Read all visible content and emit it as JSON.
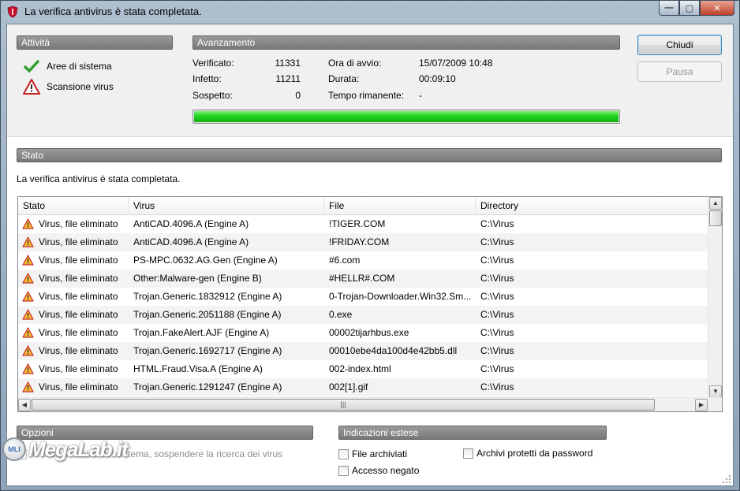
{
  "window": {
    "title": "La verifica antivirus è stata completata."
  },
  "activity": {
    "header": "Attività",
    "items": [
      {
        "label": "Aree di sistema",
        "icon": "check-icon"
      },
      {
        "label": "Scansione virus",
        "icon": "warning-icon"
      }
    ]
  },
  "progress": {
    "header": "Avanzamento",
    "verified_label": "Verificato:",
    "verified_value": "11331",
    "infected_label": "Infetto:",
    "infected_value": "11211",
    "suspect_label": "Sospetto:",
    "suspect_value": "0",
    "start_label": "Ora di avvio:",
    "start_value": "15/07/2009 10:48",
    "duration_label": "Durata:",
    "duration_value": "00:09:10",
    "remaining_label": "Tempo rimanente:",
    "remaining_value": "-",
    "fraction": 1.0
  },
  "buttons": {
    "close_label": "Chiudi",
    "pause_label": "Pausa"
  },
  "status": {
    "header": "Stato",
    "message": "La verifica antivirus è stata completata.",
    "columns": [
      "Stato",
      "Virus",
      "File",
      "Directory"
    ],
    "rows": [
      {
        "stato": "Virus, file eliminato",
        "virus": "AntiCAD.4096.A (Engine A)",
        "file": "!TIGER.COM",
        "dir": "C:\\Virus"
      },
      {
        "stato": "Virus, file eliminato",
        "virus": "AntiCAD.4096.A (Engine A)",
        "file": "!FRIDAY.COM",
        "dir": "C:\\Virus"
      },
      {
        "stato": "Virus, file eliminato",
        "virus": "PS-MPC.0632.AG.Gen (Engine A)",
        "file": "#6.com",
        "dir": "C:\\Virus"
      },
      {
        "stato": "Virus, file eliminato",
        "virus": "Other:Malware-gen (Engine B)",
        "file": "#HELLR#.COM",
        "dir": "C:\\Virus"
      },
      {
        "stato": "Virus, file eliminato",
        "virus": "Trojan.Generic.1832912 (Engine A)",
        "file": "0-Trojan-Downloader.Win32.Sm...",
        "dir": "C:\\Virus"
      },
      {
        "stato": "Virus, file eliminato",
        "virus": "Trojan.Generic.2051188 (Engine A)",
        "file": "0.exe",
        "dir": "C:\\Virus"
      },
      {
        "stato": "Virus, file eliminato",
        "virus": "Trojan.FakeAlert.AJF (Engine A)",
        "file": "00002tijarhbus.exe",
        "dir": "C:\\Virus"
      },
      {
        "stato": "Virus, file eliminato",
        "virus": "Trojan.Generic.1692717 (Engine A)",
        "file": "00010ebe4da100d4e42bb5.dll",
        "dir": "C:\\Virus"
      },
      {
        "stato": "Virus, file eliminato",
        "virus": "HTML.Fraud.Visa.A (Engine A)",
        "file": "002-index.html",
        "dir": "C:\\Virus"
      },
      {
        "stato": "Virus, file eliminato",
        "virus": "Trojan.Generic.1291247 (Engine A)",
        "file": "002[1].gif",
        "dir": "C:\\Virus"
      }
    ]
  },
  "options": {
    "header": "Opzioni",
    "suspend_label": "In caso di carico del sistema, sospendere la ricerca dei virus"
  },
  "extended": {
    "header": "Indicazioni estese",
    "archived_label": "File archiviati",
    "protected_label": "Archivi protetti da password",
    "denied_label": "Accesso negato"
  },
  "watermark": {
    "text": "MegaLab.it",
    "badge": "MLI"
  }
}
